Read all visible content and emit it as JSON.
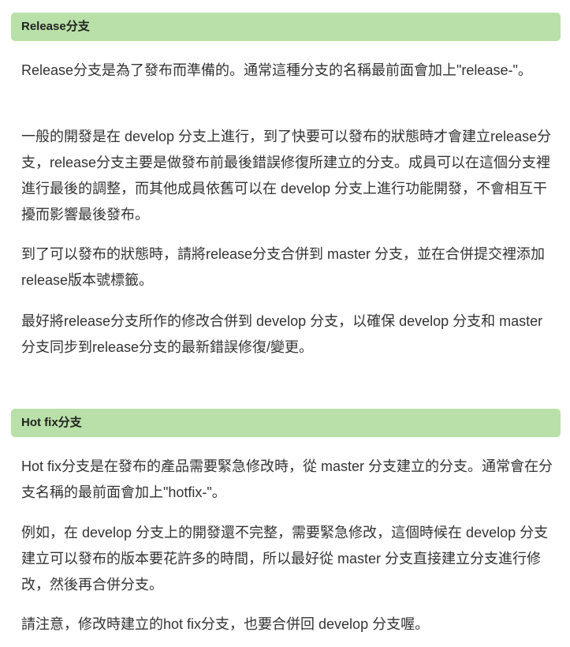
{
  "sections": [
    {
      "heading": "Release分支",
      "paragraphs": [
        "Release分支是為了發布而準備的。通常這種分支的名稱最前面會加上\"release-\"。",
        "一般的開發是在 develop 分支上進行，到了快要可以發布的狀態時才會建立release分支，release分支主要是做發布前最後錯誤修復所建立的分支。成員可以在這個分支裡進行最後的調整，而其他成員依舊可以在 develop 分支上進行功能開發，不會相互干擾而影響最後發布。",
        "到了可以發布的狀態時，請將release分支合併到 master 分支，並在合併提交裡添加release版本號標籤。",
        "最好將release分支所作的修改合併到 develop 分支，以確保 develop 分支和 master 分支同步到release分支的最新錯誤修復/變更。"
      ]
    },
    {
      "heading": "Hot fix分支",
      "paragraphs": [
        "Hot fix分支是在發布的產品需要緊急修改時，從 master 分支建立的分支。通常會在分支名稱的最前面會加上\"hotfix-\"。",
        "例如，在 develop 分支上的開發還不完整，需要緊急修改，這個時候在 develop 分支建立可以發布的版本要花許多的時間，所以最好從 master 分支直接建立分支進行修改，然後再合併分支。",
        "請注意，修改時建立的hot fix分支，也要合併回 develop 分支喔。"
      ]
    }
  ]
}
